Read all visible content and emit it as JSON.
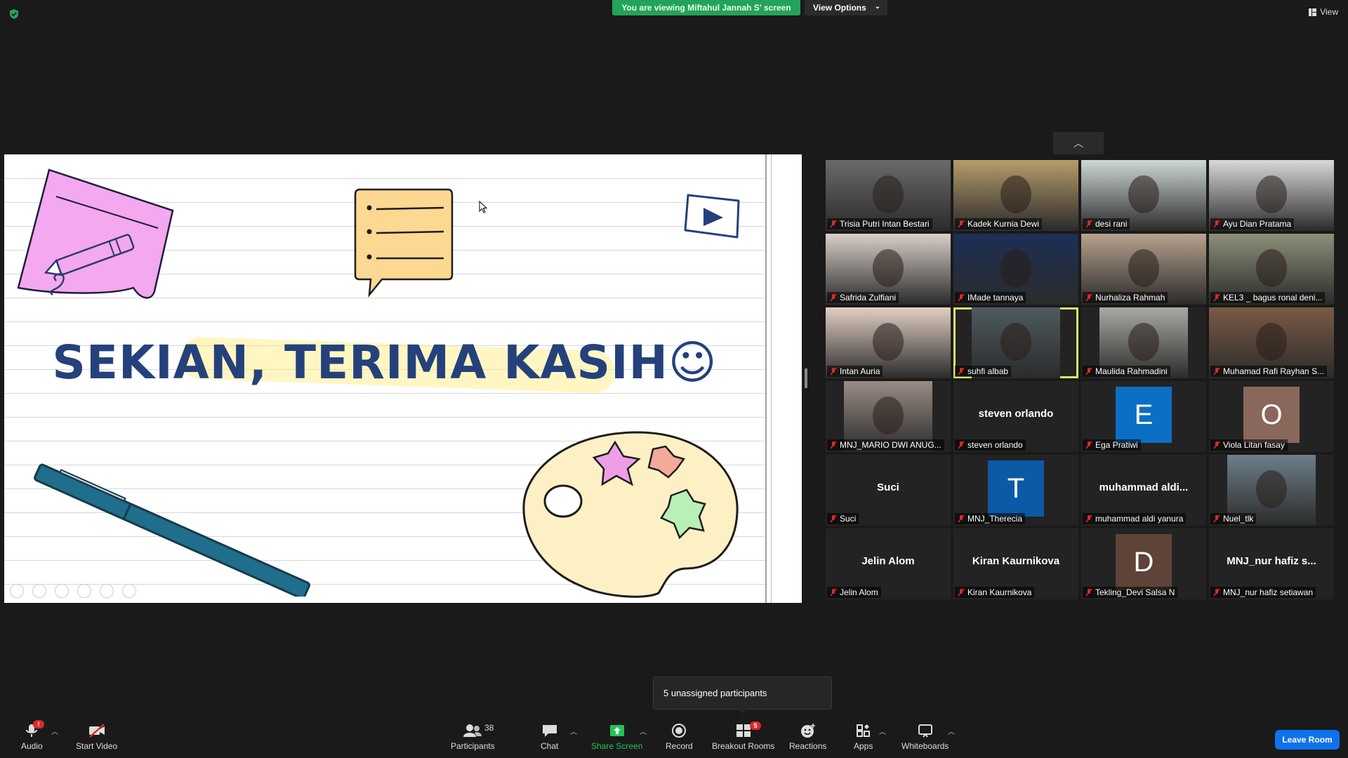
{
  "top": {
    "viewing_banner": "You are viewing Miftahul Jannah S' screen",
    "view_options": "View Options",
    "view_button": "View"
  },
  "slide": {
    "title": "SEKIAN, TERIMA KASIH☺"
  },
  "participants": [
    {
      "name": "Trisia Putri Intan Bestari",
      "type": "video",
      "bg": "#6a6a6a"
    },
    {
      "name": "Kadek Kurnia Dewi",
      "type": "video",
      "bg": "#b79c6a"
    },
    {
      "name": "desi rani",
      "type": "video",
      "bg": "#cfd8d4"
    },
    {
      "name": "Ayu Dian Pratama",
      "type": "video",
      "bg": "#d9d9d9"
    },
    {
      "name": "Safrida Zulfiani",
      "type": "video",
      "bg": "#d9cfc9"
    },
    {
      "name": "IMade tannaya",
      "type": "video",
      "bg": "#1c2f55"
    },
    {
      "name": "Nurhaliza Rahmah",
      "type": "video",
      "bg": "#b8a28d"
    },
    {
      "name": "KEL3 _ bagus ronal deni...",
      "type": "video",
      "bg": "#8d8f7a"
    },
    {
      "name": "Intan Auria",
      "type": "video",
      "bg": "#e2cfc5"
    },
    {
      "name": "suhfi albab",
      "type": "video",
      "bg": "#4f5a5f",
      "speaking": true
    },
    {
      "name": "Maulida Rahmadini",
      "type": "video",
      "bg": "#a9a9a4"
    },
    {
      "name": "Muhamad Rafi Rayhan S...",
      "type": "video",
      "bg": "#7a5a44"
    },
    {
      "name": "MNJ_MARIO DWI ANUG...",
      "type": "video",
      "bg": "#9a8c85"
    },
    {
      "name": "steven orlando",
      "type": "name",
      "big": "steven orlando"
    },
    {
      "name": "Ega Pratiwi",
      "type": "avatar",
      "letter": "E",
      "bg": "#0b6fc4"
    },
    {
      "name": "Viola Litan fasay",
      "type": "avatar",
      "letter": "O",
      "bg": "#8a675b"
    },
    {
      "name": "Suci",
      "type": "name",
      "big": "Suci"
    },
    {
      "name": "MNJ_Therecia",
      "type": "avatar",
      "letter": "T",
      "bg": "#0c5aa6"
    },
    {
      "name": "muhammad aldi yanura",
      "type": "name",
      "big": "muhammad  aldi..."
    },
    {
      "name": "Nuel_tlk",
      "type": "video",
      "bg": "#6d7f8a"
    },
    {
      "name": "Jelin Alom",
      "type": "name",
      "big": "Jelin Alom"
    },
    {
      "name": "Kiran Kaurnikova",
      "type": "name",
      "big": "Kiran Kaurnikova"
    },
    {
      "name": "Tekling_Devi Salsa N",
      "type": "avatar",
      "letter": "D",
      "bg": "#5e4339"
    },
    {
      "name": "MNJ_nur hafiz setiawan",
      "type": "name",
      "big": "MNJ_nur  hafiz s..."
    }
  ],
  "popup": {
    "unassigned": "5 unassigned participants"
  },
  "toolbar": {
    "audio": "Audio",
    "audio_badge": "!",
    "start_video": "Start Video",
    "participants": "Participants",
    "participants_count": "38",
    "chat": "Chat",
    "share_screen": "Share Screen",
    "record": "Record",
    "breakout_rooms": "Breakout Rooms",
    "breakout_badge": "5",
    "reactions": "Reactions",
    "apps": "Apps",
    "whiteboards": "Whiteboards",
    "leave": "Leave Room"
  },
  "colors": {
    "share_green": "#23a35a",
    "leave_blue": "#0e72ed",
    "speaker_outline": "#d6e86a"
  }
}
